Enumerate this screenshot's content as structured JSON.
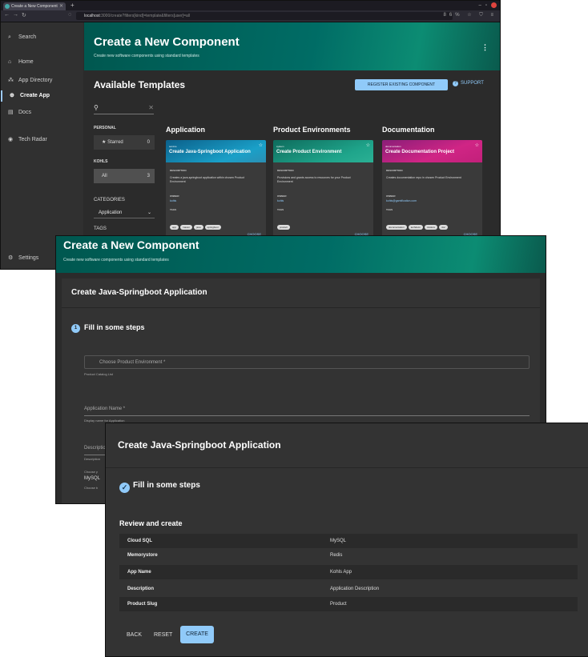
{
  "browser": {
    "tab_title": "Create a New Component",
    "url_host": "localhost",
    "url_path": ":3000/create?filters[kind]=template&filters[user]=all",
    "url_badge": "86%"
  },
  "sidebar": {
    "items": [
      {
        "label": "Search",
        "icon": "search-icon"
      },
      {
        "label": "Home",
        "icon": "home-icon"
      },
      {
        "label": "App Directory",
        "icon": "directory-icon"
      },
      {
        "label": "Create App",
        "icon": "add-circle-icon"
      },
      {
        "label": "Docs",
        "icon": "docs-icon"
      },
      {
        "label": "Tech Radar",
        "icon": "radar-icon"
      },
      {
        "label": "Settings",
        "icon": "gear-icon"
      }
    ]
  },
  "header": {
    "title": "Create a New Component",
    "subtitle": "Create new software components using standard templates"
  },
  "templates": {
    "title": "Available Templates",
    "register_button": "REGISTER EXISTING COMPONENT",
    "support": "SUPPORT",
    "personal_label": "PERSONAL",
    "starred": {
      "label": "Starred",
      "count": "0"
    },
    "org_label": "KOHLS",
    "all": {
      "label": "All",
      "count": "3"
    },
    "categories_label": "CATEGORIES",
    "category_value": "Application",
    "tags_label": "TAGS",
    "description_label": "DESCRIPTION",
    "owner_label": "OWNER",
    "tags_key": "TAGS",
    "choose_label": "CHOOSE",
    "columns": [
      {
        "heading": "Application",
        "card_tag": "service",
        "card_title": "Create Java-Springboot Application",
        "description": "Creates a java-springboot application within chosen Product Environment",
        "owner": "kohls",
        "chips": [
          "app",
          "maven",
          "java",
          "springboot"
        ]
      },
      {
        "heading": "Product Environments",
        "card_tag": "system",
        "card_title": "Create Product Environment",
        "description": "Provisions and grants access to resources for your Product Environment",
        "owner": "kohls",
        "chips": [
          "product"
        ]
      },
      {
        "heading": "Documentation",
        "card_tag": "documentation",
        "card_title": "Create Documentation Project",
        "description": "Creates documentation repo in chosen Product Environment",
        "owner": "kohls@gamification.com",
        "chips": [
          "documentation",
          "techdocs",
          "mkdocs",
          "doc"
        ]
      }
    ],
    "colors": {
      "app_banner": "#0b5f8a",
      "env_banner": "#1a8f7c",
      "doc_banner": "#c2207a",
      "accent": "#90caf9"
    }
  },
  "form": {
    "header_title": "Create a New Component",
    "header_subtitle": "Create new software components using standard templates",
    "title": "Create Java-Springboot Application",
    "step_number": "1",
    "step": "Fill in some steps",
    "product_env_placeholder": "Choose Product Environment *",
    "product_env_helper": "Product Catalog List",
    "app_name_placeholder": "Application Name *",
    "app_name_helper": "Display name for Application",
    "description_placeholder": "Description",
    "description_helper": "Description",
    "choose_helper": "Choose y",
    "db_value": "MySQL",
    "db_helper": "Choose b"
  },
  "review": {
    "title": "Create Java-Springboot Application",
    "step": "Fill in some steps",
    "section": "Review and create",
    "rows": [
      {
        "key": "Cloud SQL",
        "value": "MySQL"
      },
      {
        "key": "Memorystore",
        "value": "Redis"
      },
      {
        "key": "App Name",
        "value": "Kohls App"
      },
      {
        "key": "Description",
        "value": "Application Description"
      },
      {
        "key": "Product Slug",
        "value": "Product"
      }
    ],
    "back": "BACK",
    "reset": "RESET",
    "create": "CREATE"
  }
}
